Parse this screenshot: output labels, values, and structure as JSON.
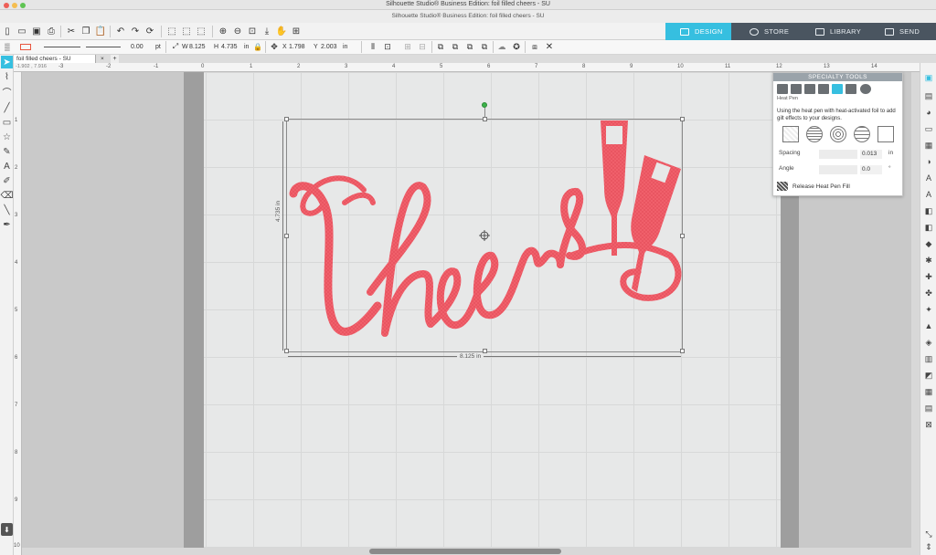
{
  "window": {
    "app_title": "Silhouette Studio® Business Edition: foil filled cheers - SU",
    "doc_title": "Silhouette Studio® Business Edition: foil filled cheers - SU"
  },
  "nav": {
    "tabs": [
      {
        "label": "DESIGN",
        "icon": "grid-icon",
        "active": true
      },
      {
        "label": "STORE",
        "icon": "store-icon",
        "active": false
      },
      {
        "label": "LIBRARY",
        "icon": "library-icon",
        "active": false
      },
      {
        "label": "SEND",
        "icon": "send-icon",
        "active": false
      }
    ],
    "active_color": "#36bfe0",
    "bar_color": "#4a5560"
  },
  "toolbar2": {
    "line_width": "0.00",
    "line_unit": "pt",
    "w_label": "W",
    "w_value": "8.125",
    "h_label": "H",
    "h_value": "4.735",
    "size_unit": "in",
    "x_label": "X",
    "x_value": "1.798",
    "y_label": "Y",
    "y_value": "2.003",
    "pos_unit": "in"
  },
  "document": {
    "tab_label": "foil filled cheers - SU",
    "close_symbol": "×",
    "add_symbol": "+",
    "cursor_coords": "-1.902 , 7.916"
  },
  "ruler": {
    "top_ticks": [
      "-3",
      "-2",
      "-1",
      "0",
      "1",
      "2",
      "3",
      "4",
      "5",
      "6",
      "7",
      "8",
      "9",
      "10",
      "11",
      "12",
      "13",
      "14"
    ],
    "left_ticks": [
      "1",
      "2",
      "3",
      "4",
      "5",
      "6",
      "7",
      "8",
      "9",
      "10"
    ]
  },
  "design": {
    "text": "Cheers",
    "fill_color": "#f0606b",
    "width_label": "8.125 in",
    "height_label": "4.735 in"
  },
  "specialty_panel": {
    "title": "SPECIALTY TOOLS",
    "tool_name": "Heat Pen",
    "description": "Using the heat pen with heat-activated foil to add gilt effects to your designs.",
    "spacing_label": "Spacing",
    "spacing_value": "0.013",
    "spacing_unit": "in",
    "angle_label": "Angle",
    "angle_value": "0.0",
    "angle_unit": "°",
    "release_label": "Release Heat Pen Fill"
  }
}
